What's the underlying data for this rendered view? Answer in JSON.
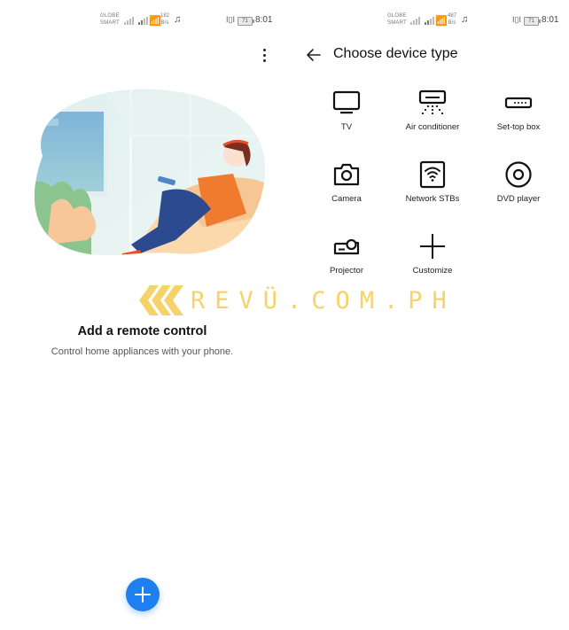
{
  "left_screen": {
    "status_bar": {
      "carrier_line1": "GLOBE",
      "carrier_line2": "SMART",
      "speed_value": "182",
      "speed_unit": "B/s",
      "battery": "71",
      "time": "8:01"
    },
    "menu_icon": "more-vertical-icon",
    "empty_state": {
      "title": "Add a remote control",
      "subtitle": "Control home appliances with your phone."
    },
    "fab_icon": "plus-icon"
  },
  "right_screen": {
    "status_bar": {
      "carrier_line1": "GLOBE",
      "carrier_line2": "SMART",
      "speed_value": "487",
      "speed_unit": "B/s",
      "battery": "71",
      "time": "8:01"
    },
    "header": {
      "back_icon": "arrow-left-icon",
      "title": "Choose device type"
    },
    "device_types": [
      {
        "label": "TV",
        "icon": "tv-icon"
      },
      {
        "label": "Air conditioner",
        "icon": "air-conditioner-icon"
      },
      {
        "label": "Set-top box",
        "icon": "set-top-box-icon"
      },
      {
        "label": "Camera",
        "icon": "camera-icon"
      },
      {
        "label": "Network STBs",
        "icon": "network-stb-icon"
      },
      {
        "label": "DVD player",
        "icon": "dvd-icon"
      },
      {
        "label": "Projector",
        "icon": "projector-icon"
      },
      {
        "label": "Customize",
        "icon": "plus-icon"
      }
    ]
  },
  "watermark": {
    "text": "REVÜ.COM.PH",
    "color": "#f5cf5a"
  },
  "colors": {
    "accent": "#1f7ef0",
    "text_primary": "#111111",
    "text_secondary": "#555555"
  }
}
